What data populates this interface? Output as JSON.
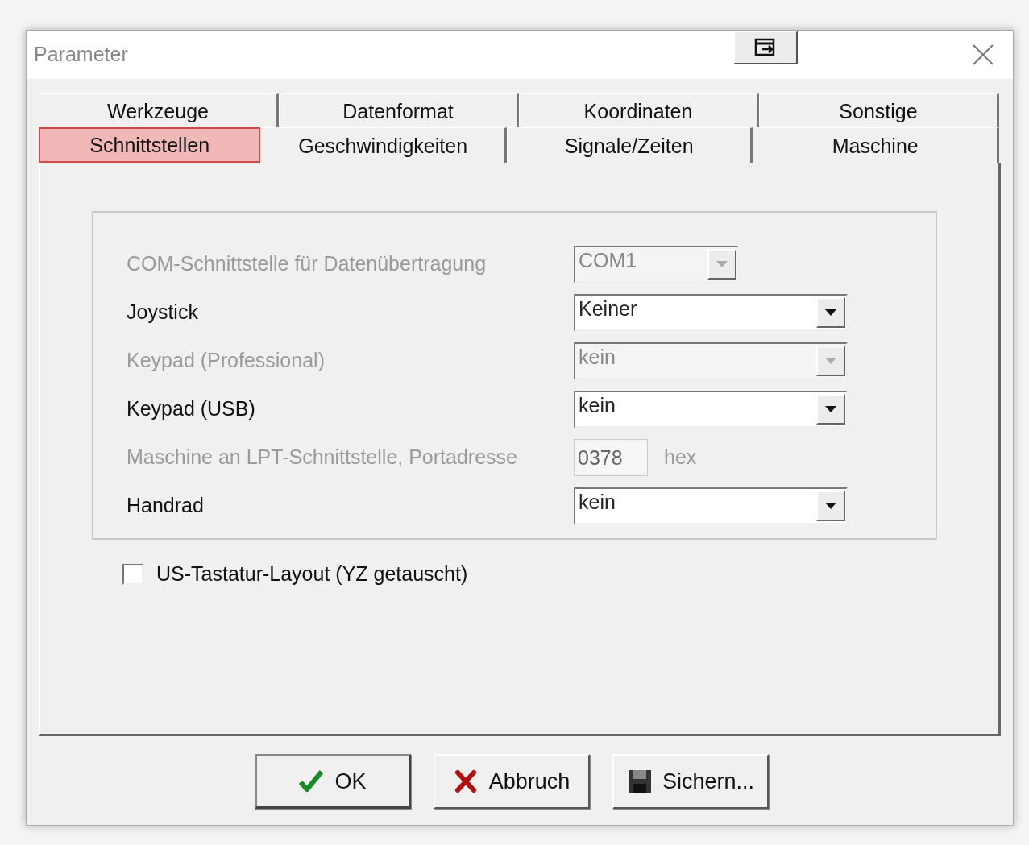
{
  "window": {
    "title": "Parameter"
  },
  "tab_rows": [
    [
      {
        "label": "Werkzeuge",
        "selected": false
      },
      {
        "label": "Datenformat",
        "selected": false
      },
      {
        "label": "Koordinaten",
        "selected": false
      },
      {
        "label": "Sonstige",
        "selected": false
      }
    ],
    [
      {
        "label": "Schnittstellen",
        "selected": true
      },
      {
        "label": "Geschwindigkeiten",
        "selected": false
      },
      {
        "label": "Signale/Zeiten",
        "selected": false
      },
      {
        "label": "Maschine",
        "selected": false
      }
    ]
  ],
  "fields": [
    {
      "label": "COM-Schnittstelle für Datenübertragung",
      "kind": "short_combo",
      "value": "COM1",
      "disabled": true
    },
    {
      "label": "Joystick",
      "kind": "combo",
      "value": "Keiner",
      "disabled": false
    },
    {
      "label": "Keypad (Professional)",
      "kind": "combo",
      "value": "kein",
      "disabled": true
    },
    {
      "label": "Keypad (USB)",
      "kind": "combo",
      "value": "kein",
      "disabled": false
    },
    {
      "label": "Maschine an LPT-Schnittstelle, Portadresse",
      "kind": "text",
      "value": "0378",
      "unit": "hex",
      "disabled": true
    },
    {
      "label": "Handrad",
      "kind": "combo",
      "value": "kein",
      "disabled": false
    }
  ],
  "checkbox": {
    "label": "US-Tastatur-Layout (YZ getauscht)",
    "checked": false
  },
  "buttons": [
    {
      "label": "OK",
      "kind": "ok"
    },
    {
      "label": "Abbruch",
      "kind": "cancel"
    },
    {
      "label": "Sichern...",
      "kind": "save"
    }
  ]
}
